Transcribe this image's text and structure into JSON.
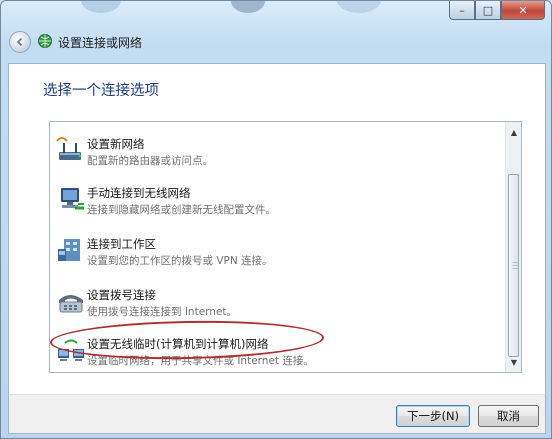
{
  "window": {
    "title": "设置连接或网络",
    "controls": {
      "minimize": "–",
      "maximize": "□",
      "close": "✕"
    }
  },
  "heading": "选择一个连接选项",
  "options": [
    {
      "title": "设置新网络",
      "description": "配置新的路由器或访问点。",
      "icon": "router-icon"
    },
    {
      "title": "手动连接到无线网络",
      "description": "连接到隐藏网络或创建新无线配置文件。",
      "icon": "wireless-network-icon"
    },
    {
      "title": "连接到工作区",
      "description": "设置到您的工作区的拨号或 VPN 连接。",
      "icon": "workplace-vpn-icon"
    },
    {
      "title": "设置拨号连接",
      "description": "使用拨号连接连接到 Internet。",
      "icon": "dialup-modem-icon"
    },
    {
      "title": "设置无线临时(计算机到计算机)网络",
      "description": "设置临时网络，用于共享文件或 Internet 连接。",
      "icon": "adhoc-network-icon"
    }
  ],
  "buttons": {
    "next": "下一步(N)",
    "cancel": "取消"
  },
  "colors": {
    "heading": "#1e3f86",
    "annotation": "#b03030"
  }
}
